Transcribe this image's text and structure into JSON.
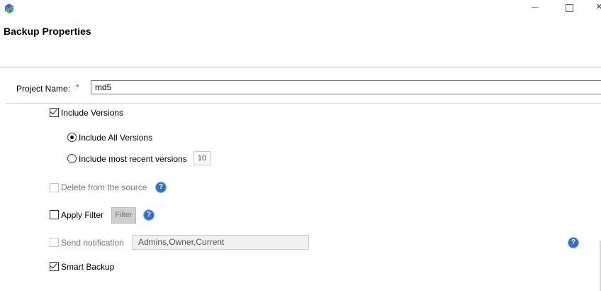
{
  "window": {
    "title": "Backup Properties",
    "logo_icon": "app-logo-icon",
    "minimize_icon": "minimize-icon",
    "maximize_icon": "maximize-icon",
    "close_icon": "close-icon"
  },
  "project": {
    "label": "Project Name:",
    "required_marker": "*",
    "value": "md5"
  },
  "versions": {
    "include_label": "Include Versions",
    "include_checked": true,
    "all_label": "Include All Versions",
    "all_selected": true,
    "recent_label": "Include most recent versions",
    "recent_selected": false,
    "recent_count": "10"
  },
  "delete_source": {
    "label": "Delete from the source",
    "checked": false,
    "enabled": false,
    "help_icon": "help-icon"
  },
  "filter": {
    "label": "Apply Filter",
    "checked": false,
    "button_label": "Filter",
    "help_icon": "help-icon"
  },
  "notification": {
    "label": "Send notification",
    "checked": false,
    "enabled": false,
    "recipients": "Admins,Owner,Current",
    "help_icon": "help-icon"
  },
  "smart_backup": {
    "label": "Smart Backup",
    "checked": true
  },
  "colors": {
    "accent_blue": "#2f73c8",
    "required_red": "#d9342b"
  }
}
